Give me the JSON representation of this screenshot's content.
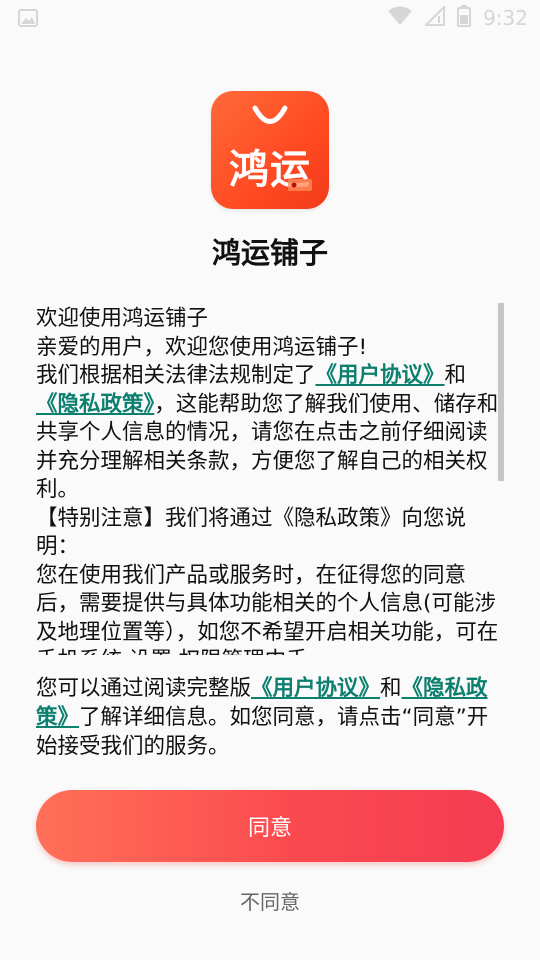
{
  "status_bar": {
    "time": "9:32",
    "icons": [
      "image-icon",
      "wifi-icon",
      "signal-icon",
      "battery-icon"
    ]
  },
  "app": {
    "logo_text": "鸿运",
    "name": "鸿运铺子"
  },
  "policy": {
    "title": "欢迎使用鸿运铺子",
    "greeting": " 亲爱的用户，欢迎您使用鸿运铺子!",
    "p1_before": " 我们根据相关法律法规制定了",
    "user_agreement": "《用户协议》",
    "and": "和",
    "privacy_policy": "《隐私政策》",
    "p1_after": "，这能帮助您了解我们使用、储存和共享个人信息的情况，请您在点击之前仔细阅读并充分理解相关条款，方便您了解自己的相关权利。",
    "special_notice": " 【特别注意】我们将通过《隐私政策》向您说明：",
    "p2": " 您在使用我们产品或服务时，在征得您的同意后，需要提供与具体功能相关的个人信息(可能涉及地理位置等），如您不希望开启相关功能，可在手机系统 设置 权限管理中手"
  },
  "summary": {
    "before": "您可以通过阅读完整版",
    "user_agreement": "《用户协议》",
    "and": "和",
    "privacy_policy": "《隐私政策》",
    "after": "了解详细信息。如您同意，请点击“同意”开始接受我们的服务。"
  },
  "buttons": {
    "agree": "同意",
    "disagree": "不同意"
  },
  "colors": {
    "accent_link": "#0d7f6f",
    "button_start": "#ff7058",
    "button_end": "#f53c52",
    "logo_bg": "#ff4a22"
  }
}
